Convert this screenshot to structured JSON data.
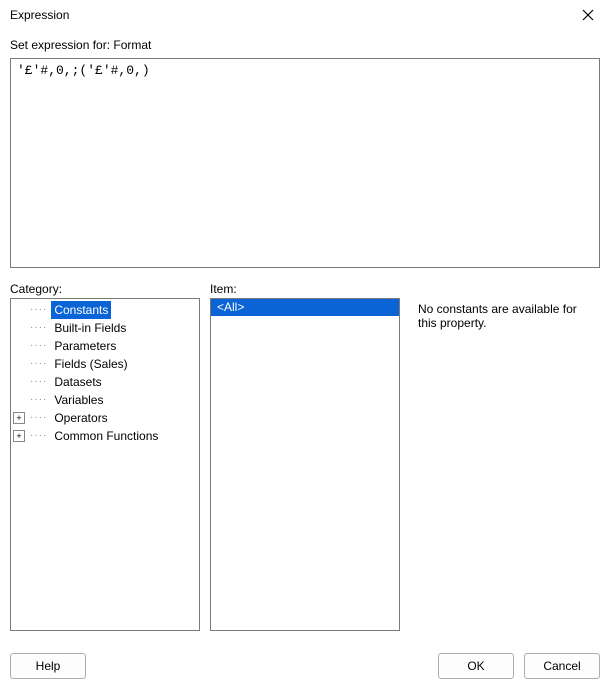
{
  "dialog": {
    "title": "Expression",
    "close_icon": "close"
  },
  "subtitle": "Set expression for: Format",
  "expression": {
    "value": "'£'#,0,;('£'#,0,)"
  },
  "labels": {
    "category": "Category:",
    "item": "Item:"
  },
  "category_tree": [
    {
      "label": "Constants",
      "expandable": false,
      "selected": true
    },
    {
      "label": "Built-in Fields",
      "expandable": false,
      "selected": false
    },
    {
      "label": "Parameters",
      "expandable": false,
      "selected": false
    },
    {
      "label": "Fields (Sales)",
      "expandable": false,
      "selected": false
    },
    {
      "label": "Datasets",
      "expandable": false,
      "selected": false
    },
    {
      "label": "Variables",
      "expandable": false,
      "selected": false
    },
    {
      "label": "Operators",
      "expandable": true,
      "selected": false
    },
    {
      "label": "Common Functions",
      "expandable": true,
      "selected": false
    }
  ],
  "items": [
    {
      "label": "<All>",
      "selected": true
    }
  ],
  "help_text": "No constants are available for this property.",
  "buttons": {
    "help": "Help",
    "ok": "OK",
    "cancel": "Cancel"
  }
}
